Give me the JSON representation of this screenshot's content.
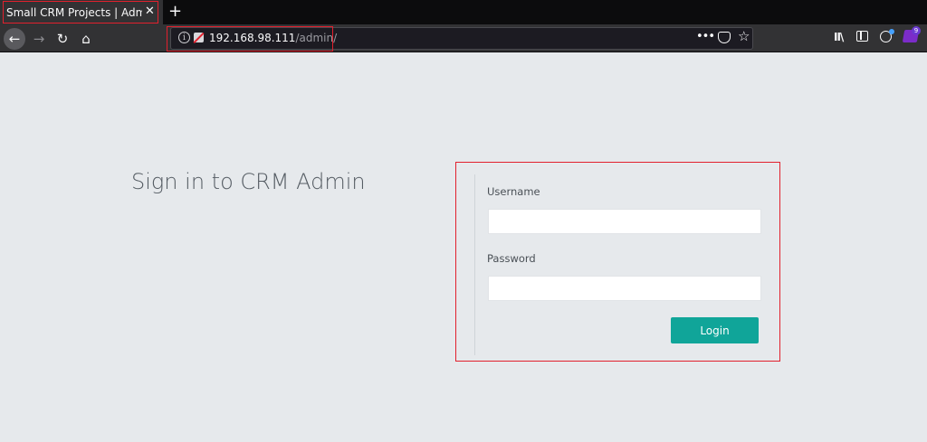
{
  "browser": {
    "tab": {
      "title": "Small CRM Projects | Admin",
      "close_glyph": "✕"
    },
    "new_tab_glyph": "+",
    "nav": {
      "back_glyph": "←",
      "forward_glyph": "→",
      "reload_glyph": "↻",
      "home_glyph": "⌂"
    },
    "url": {
      "host": "192.168.98.111",
      "path": "/admin/"
    },
    "more_glyph": "•••",
    "star_glyph": "☆",
    "library_glyph": "II\\",
    "extension_badge": "9",
    "info_glyph": "i"
  },
  "page": {
    "heading": "Sign in to CRM Admin",
    "form": {
      "username_label": "Username",
      "password_label": "Password",
      "username_value": "",
      "password_value": "",
      "login_label": "Login"
    }
  },
  "colors": {
    "background": "#e6e9ec",
    "accent_button": "#10a599",
    "highlight_outline": "#e2202d",
    "browser_chrome": "#323234"
  }
}
